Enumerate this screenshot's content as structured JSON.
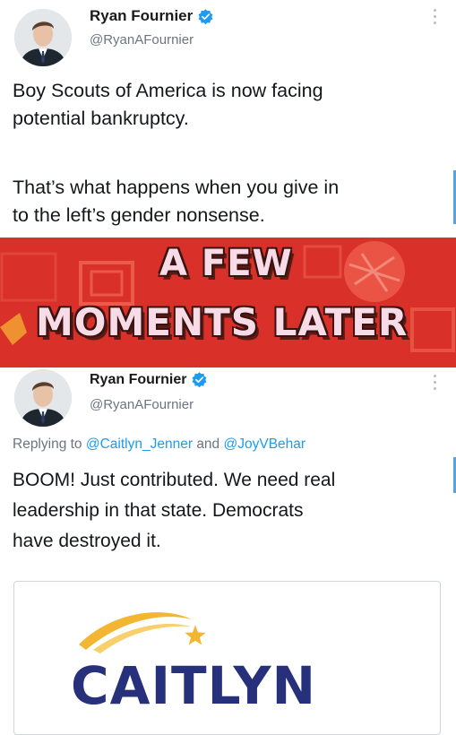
{
  "tweet1": {
    "author_name": "Ryan Fournier",
    "handle": "@RyanAFournier",
    "line1": "Boy Scouts of America is now facing",
    "line2": "potential bankruptcy.",
    "line3": "That’s what happens when you give in",
    "line4": "to the left’s gender nonsense."
  },
  "banner": {
    "line1": "A FEW",
    "line2": "MOMENTS LATER"
  },
  "tweet2": {
    "author_name": "Ryan Fournier",
    "handle": "@RyanAFournier",
    "replying_prefix": "Replying to",
    "mention1": "@Caitlyn_Jenner",
    "and_text": "and",
    "mention2": "@JoyVBehar",
    "line1": "BOOM! Just contributed. We need real",
    "line2": "leadership in that state. Democrats",
    "line3": "have destroyed it.",
    "card_logo_text": "CAITLYN"
  },
  "colors": {
    "verified": "#1d9bf0",
    "mention": "#1d9bf0",
    "banner_bg": "#d9302a",
    "banner_text": "#f7dce8",
    "logo_navy": "#27317b",
    "logo_gold": "#f2b632"
  },
  "icons": [
    "verified-badge-icon",
    "more-options-icon",
    "star-icon"
  ]
}
